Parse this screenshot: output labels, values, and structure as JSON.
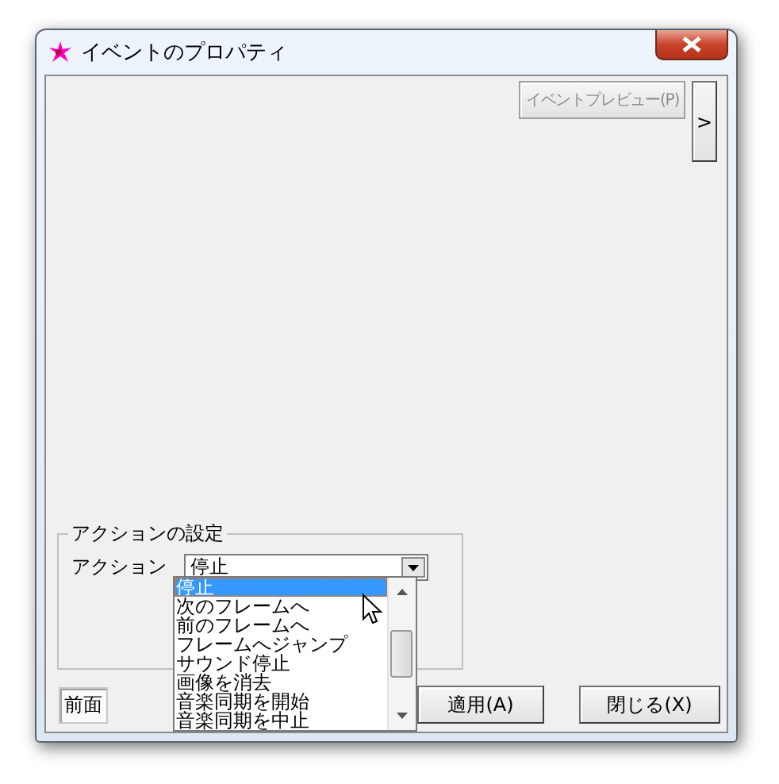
{
  "window": {
    "title": "イベントのプロパティ"
  },
  "preview_button": {
    "label": "イベントプレビュー(P)",
    "disabled": true
  },
  "expand_button": {
    "label": ">"
  },
  "action_settings": {
    "title": "アクションの設定",
    "action_label": "アクション",
    "action_value": "停止"
  },
  "dropdown_list": [
    {
      "label": "停止",
      "selected": true
    },
    {
      "label": "次のフレームへ",
      "selected": false
    },
    {
      "label": "前のフレームへ",
      "selected": false
    },
    {
      "label": "フレームへジャンプ",
      "selected": false
    },
    {
      "label": "サウンド停止",
      "selected": false
    },
    {
      "label": "画像を消去",
      "selected": false
    },
    {
      "label": "音楽同期を開始",
      "selected": false
    },
    {
      "label": "音楽同期を中止",
      "selected": false
    }
  ],
  "buttons": [
    {
      "label": "前面",
      "kind": "toggle"
    },
    {
      "label": "適用(A)",
      "kind": "push"
    },
    {
      "label": "閉じる(X)",
      "kind": "push"
    }
  ]
}
